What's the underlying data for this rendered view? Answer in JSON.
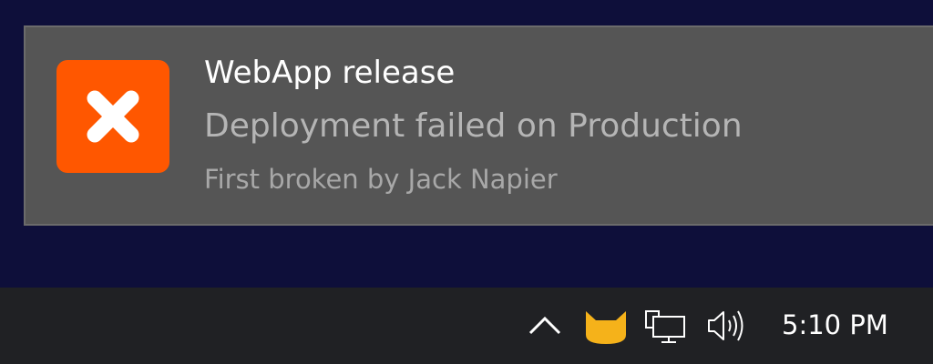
{
  "notification": {
    "icon": "close-x-icon",
    "icon_color": "#ff5700",
    "title": "WebApp release",
    "message": "Deployment failed on Production",
    "attribution": "First broken by Jack Napier"
  },
  "taskbar": {
    "tray_icons": [
      "chevron-up-icon",
      "cat-app-icon",
      "network-icon",
      "volume-icon"
    ],
    "clock": "5:10 PM"
  },
  "colors": {
    "desktop": "#0e0f3a",
    "toast_background": "#555555",
    "taskbar": "#202124",
    "cat_icon": "#f5b21a"
  }
}
